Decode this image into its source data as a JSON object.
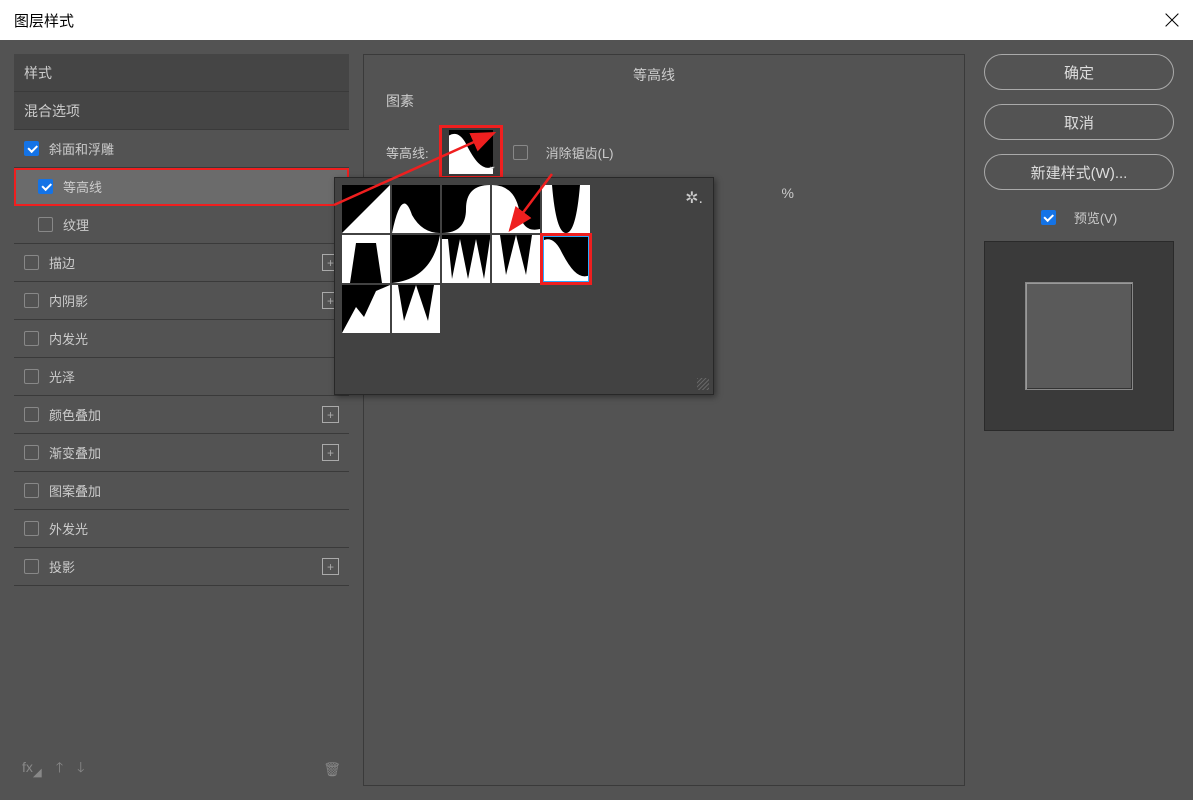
{
  "title": "图层样式",
  "left": {
    "header1": "样式",
    "header2": "混合选项",
    "items": [
      {
        "label": "斜面和浮雕",
        "checked": true,
        "indent": false,
        "plus": false,
        "highlighted": false,
        "selected": false
      },
      {
        "label": "等高线",
        "checked": true,
        "indent": true,
        "plus": false,
        "highlighted": true,
        "selected": true
      },
      {
        "label": "纹理",
        "checked": false,
        "indent": true,
        "plus": false,
        "highlighted": false,
        "selected": false
      },
      {
        "label": "描边",
        "checked": false,
        "indent": false,
        "plus": true,
        "highlighted": false,
        "selected": false
      },
      {
        "label": "内阴影",
        "checked": false,
        "indent": false,
        "plus": true,
        "highlighted": false,
        "selected": false
      },
      {
        "label": "内发光",
        "checked": false,
        "indent": false,
        "plus": false,
        "highlighted": false,
        "selected": false
      },
      {
        "label": "光泽",
        "checked": false,
        "indent": false,
        "plus": false,
        "highlighted": false,
        "selected": false
      },
      {
        "label": "颜色叠加",
        "checked": false,
        "indent": false,
        "plus": true,
        "highlighted": false,
        "selected": false
      },
      {
        "label": "渐变叠加",
        "checked": false,
        "indent": false,
        "plus": true,
        "highlighted": false,
        "selected": false
      },
      {
        "label": "图案叠加",
        "checked": false,
        "indent": false,
        "plus": false,
        "highlighted": false,
        "selected": false
      },
      {
        "label": "外发光",
        "checked": false,
        "indent": false,
        "plus": false,
        "highlighted": false,
        "selected": false
      },
      {
        "label": "投影",
        "checked": false,
        "indent": false,
        "plus": true,
        "highlighted": false,
        "selected": false
      }
    ]
  },
  "center": {
    "section_title": "等高线",
    "sub_title": "图素",
    "contour_label": "等高线:",
    "antialias_label": "消除锯齿(L)",
    "percent": "%"
  },
  "right": {
    "ok": "确定",
    "cancel": "取消",
    "new_style": "新建样式(W)...",
    "preview": "预览(V)"
  }
}
